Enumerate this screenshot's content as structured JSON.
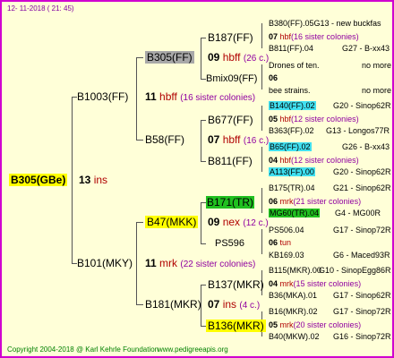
{
  "timestamp": "12- 11-2018 ( 21: 45)",
  "root": {
    "name": "B305(GBe)",
    "gen": "13",
    "code": "ins"
  },
  "p1": {
    "name": "B1003(FF)",
    "gen": "11",
    "code": "hbff",
    "sisters": "(16 sister colonies)"
  },
  "p2": {
    "name": "B101(MKY)",
    "gen": "11",
    "code": "mrk",
    "sisters": "(22 sister colonies)"
  },
  "g1": {
    "name": "B305(FF)",
    "gen": "09",
    "code": "hbff",
    "sisters": "(26 c.)"
  },
  "g2": {
    "name": "B58(FF)",
    "gen": "07",
    "code": "hbff",
    "sisters": "(16 c.)"
  },
  "g3": {
    "name": "B47(MKK)",
    "gen": "09",
    "code": "nex",
    "sisters": "(12 c.)"
  },
  "g4": {
    "name": "B181(MKR)",
    "gen": "07",
    "code": "ins",
    "sisters": "(4 c.)"
  },
  "ggg": [
    {
      "name": "B187(FF)",
      "gen": "07",
      "code": "hbf",
      "sisters": "(16 sister colonies)",
      "top": "B380(FF).05G13 - new buckfas",
      "bottom": "B811(FF).04",
      "bottom_loc": "G27 - B-xx43"
    },
    {
      "name": "Bmix09(FF)",
      "gen": "06",
      "code": "",
      "sisters": "",
      "top": "Drones of ten.",
      "top_loc": "no more",
      "bottom": "bee strains.",
      "bottom_loc": "no more"
    },
    {
      "name": "B677(FF)",
      "gen": "05",
      "code": "hbf",
      "sisters": "(12 sister colonies)",
      "top": "B140(FF).02",
      "top_loc": "G20 - Sinop62R",
      "bottom": "B363(FF).02",
      "bottom_loc": "G13 - Longos77R"
    },
    {
      "name": "B811(FF)",
      "gen": "04",
      "code": "hbf",
      "sisters": "(12 sister colonies)",
      "top": "B65(FF).02",
      "top_loc": "G26 - B-xx43",
      "bottom": "A113(FF).00",
      "bottom_loc": "G20 - Sinop62R"
    },
    {
      "name": "B171(TR)",
      "gen": "06",
      "code": "mrk",
      "sisters": "(21 sister colonies)",
      "top": "B175(TR).04",
      "top_loc": "G21 - Sinop62R",
      "bottom": "MG60(TR).04",
      "bottom_loc": "G4 - MG00R"
    },
    {
      "name": "PS596",
      "gen": "06",
      "code": "tun",
      "sisters": "",
      "top": "PS506.04",
      "top_loc": "G17 - Sinop72R",
      "bottom": "KB169.03",
      "bottom_loc": "G6 - Maced93R"
    },
    {
      "name": "B137(MKR)",
      "gen": "04",
      "code": "mrk",
      "sisters": "(15 sister colonies)",
      "top": "B115(MKR).00",
      "top_loc": "G10 - SinopEgg86R",
      "bottom": "B36(MKA).01",
      "bottom_loc": "G17 - Sinop62R"
    },
    {
      "name": "B136(MKR)",
      "gen": "05",
      "code": "mrk",
      "sisters": "(20 sister colonies)",
      "top": "B16(MKR).02",
      "top_loc": "G17 - Sinop72R",
      "bottom": "B40(MKW).02",
      "bottom_loc": "G16 - Sinop72R"
    }
  ],
  "footer": {
    "copyright": "Copyright 2004-2018 @ Karl Kehrle Foundation",
    "site": "www.pedigreeapis.org"
  }
}
